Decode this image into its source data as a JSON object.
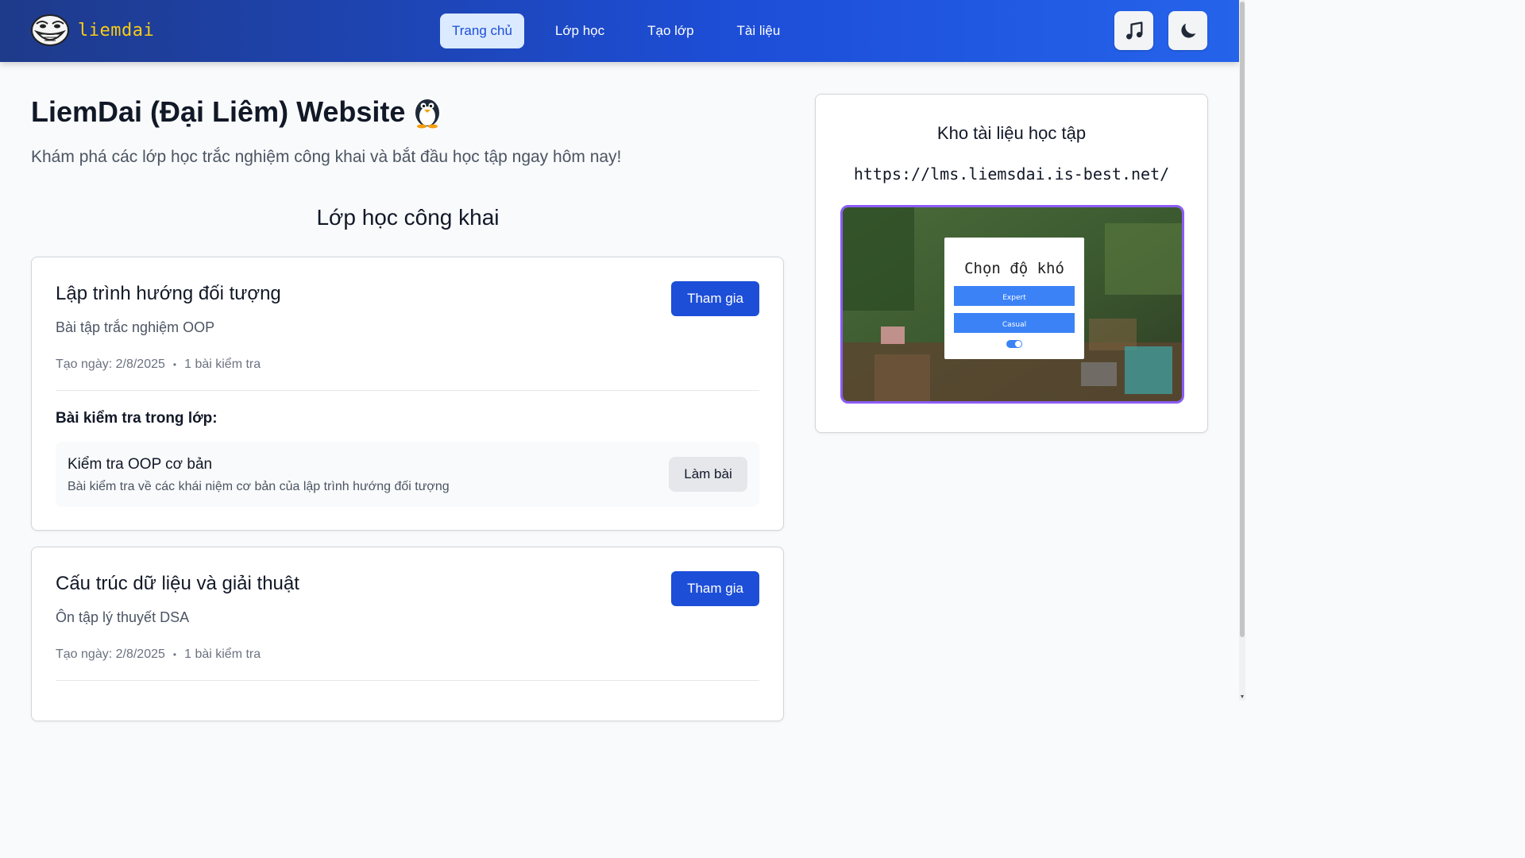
{
  "header": {
    "logo_text": "liemdai",
    "nav": [
      {
        "label": "Trang chủ",
        "active": true
      },
      {
        "label": "Lớp học",
        "active": false
      },
      {
        "label": "Tạo lớp",
        "active": false
      },
      {
        "label": "Tài liệu",
        "active": false
      }
    ],
    "icons": {
      "music": "music-note-icon",
      "theme": "moon-icon"
    }
  },
  "hero": {
    "title": "LiemDai (Đại Liêm) Website",
    "title_icon": "penguin-icon",
    "subtitle": "Khám phá các lớp học trắc nghiệm công khai và bắt đầu học tập ngay hôm nay!"
  },
  "classes": {
    "heading": "Lớp học công khai",
    "items": [
      {
        "title": "Lập trình hướng đối tượng",
        "description": "Bài tập trắc nghiệm OOP",
        "created": "Tạo ngày: 2/8/2025",
        "test_count": "1 bài kiểm tra",
        "join_label": "Tham gia",
        "tests_heading": "Bài kiểm tra trong lớp:",
        "tests": [
          {
            "name": "Kiểm tra OOP cơ bản",
            "description": "Bài kiểm tra về các khái niệm cơ bản của lập trình hướng đối tượng",
            "action": "Làm bài"
          }
        ]
      },
      {
        "title": "Cấu trúc dữ liệu và giải thuật",
        "description": "Ôn tập lý thuyết DSA",
        "created": "Tạo ngày: 2/8/2025",
        "test_count": "1 bài kiểm tra",
        "join_label": "Tham gia"
      }
    ]
  },
  "resources": {
    "title": "Kho tài liệu học tập",
    "url": "https://lms.liemsdai.is-best.net/",
    "preview": {
      "dialog_title": "Chọn độ khó",
      "options": [
        "Expert",
        "Casual"
      ]
    }
  },
  "colors": {
    "header_start": "#1e3a8a",
    "header_end": "#2563eb",
    "logo": "#facc15",
    "primary_button": "#1d4ed8",
    "preview_border": "#8b5cf6"
  }
}
